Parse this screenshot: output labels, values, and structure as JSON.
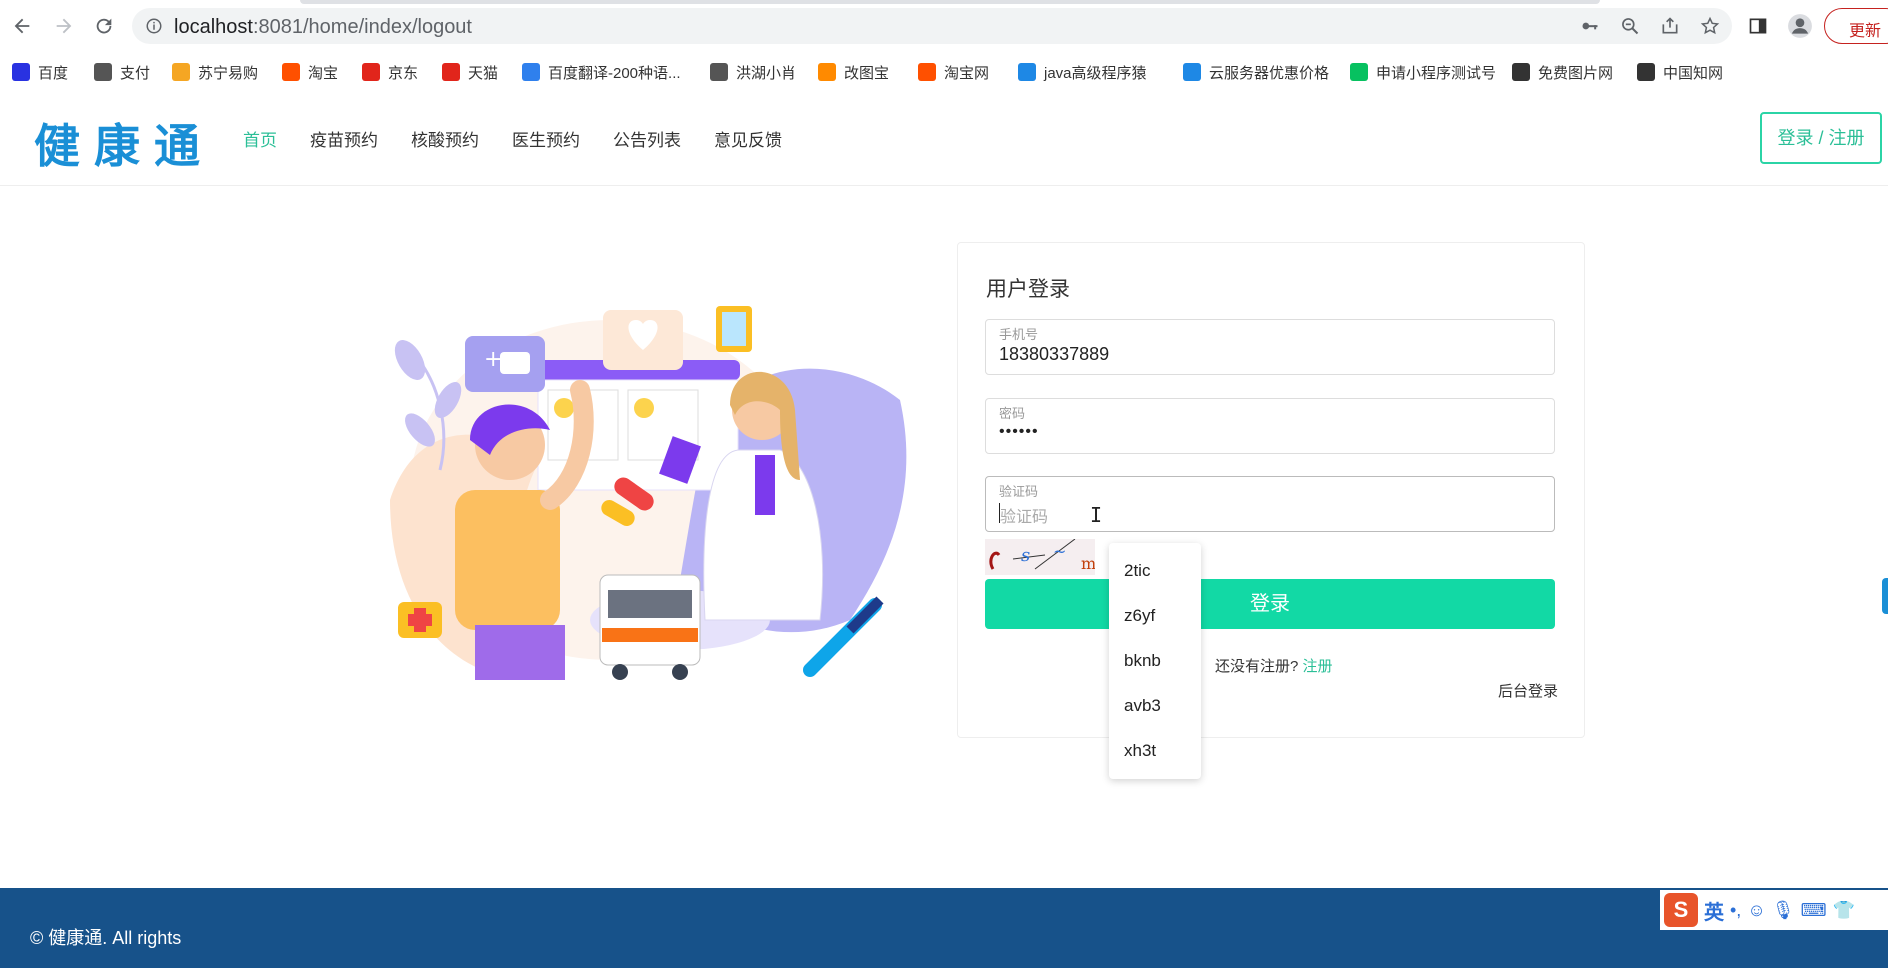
{
  "browser": {
    "url_host": "localhost",
    "url_rest": ":8081/home/index/logout",
    "update_label": "更新"
  },
  "bookmarks": [
    {
      "label": "百度",
      "color": "#2932e1",
      "icon": "paw-icon"
    },
    {
      "label": "支付",
      "color": "#555555",
      "icon": "globe-icon"
    },
    {
      "label": "苏宁易购",
      "color": "#f5a623",
      "icon": "lion-icon"
    },
    {
      "label": "淘宝",
      "color": "#ff5000",
      "icon": "taobao-icon"
    },
    {
      "label": "京东",
      "color": "#e1251b",
      "icon": "jd-icon"
    },
    {
      "label": "天猫",
      "color": "#e1251b",
      "icon": "tmall-icon"
    },
    {
      "label": "百度翻译-200种语...",
      "color": "#2f80ed",
      "icon": "translate-icon"
    },
    {
      "label": "洪湖小肖",
      "color": "#555555",
      "icon": "feather-icon"
    },
    {
      "label": "改图宝",
      "color": "#ff8a00",
      "icon": "image-icon"
    },
    {
      "label": "淘宝网",
      "color": "#ff5000",
      "icon": "taobao-icon"
    },
    {
      "label": "java高级程序猿",
      "color": "#1e88e5",
      "icon": "bilibili-icon"
    },
    {
      "label": "云服务器优惠价格",
      "color": "#1e88e5",
      "icon": "cloud-icon"
    },
    {
      "label": "申请小程序测试号",
      "color": "#07c160",
      "icon": "wechat-icon"
    },
    {
      "label": "免费图片网",
      "color": "#333333",
      "icon": "t-icon"
    },
    {
      "label": "中国知网",
      "color": "#333333",
      "icon": "cnki-icon"
    }
  ],
  "site": {
    "logo": "健康通",
    "nav": [
      "首页",
      "疫苗预约",
      "核酸预约",
      "医生预约",
      "公告列表",
      "意见反馈"
    ],
    "login_register": "登录 / 注册"
  },
  "login": {
    "title": "用户登录",
    "phone_label": "手机号",
    "phone_value": "18380337889",
    "password_label": "密码",
    "password_value": "••••••",
    "captcha_label": "验证码",
    "captcha_placeholder": "验证码",
    "submit": "登录",
    "no_account": "还没有注册?",
    "register_link": "注册",
    "admin_login": "后台登录"
  },
  "autocomplete": [
    "2tic",
    "z6yf",
    "bknb",
    "avb3",
    "xh3t"
  ],
  "footer": {
    "copyright": "© 健康通. All rights"
  },
  "ime": {
    "logo": "S",
    "lang": "英"
  },
  "colors": {
    "accent": "#12d9a5",
    "logo": "#1a8fd6",
    "footer": "#17528a"
  }
}
